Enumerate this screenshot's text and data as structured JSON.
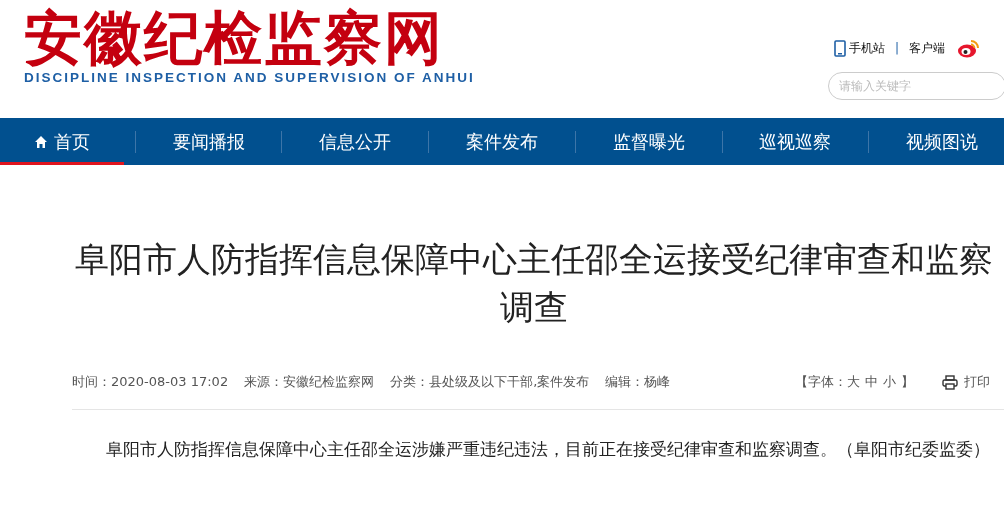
{
  "header": {
    "logo_title": "安徽纪检监察网",
    "logo_subtitle": "DISCIPLINE INSPECTION AND SUPERVISION OF ANHUI",
    "links": [
      {
        "kind": "mobile",
        "label": "手机站"
      },
      {
        "kind": "client",
        "label": "客户端"
      }
    ],
    "separator": "|",
    "search": {
      "placeholder": "请输入关键字"
    }
  },
  "nav": [
    {
      "label": "首页",
      "home": true,
      "selected": true
    },
    {
      "label": "要闻播报",
      "home": false,
      "selected": false
    },
    {
      "label": "信息公开",
      "home": false,
      "selected": false
    },
    {
      "label": "案件发布",
      "home": false,
      "selected": false
    },
    {
      "label": "监督曝光",
      "home": false,
      "selected": false
    },
    {
      "label": "巡视巡察",
      "home": false,
      "selected": false
    },
    {
      "label": "视频图说",
      "home": false,
      "selected": false
    }
  ],
  "article": {
    "title": "阜阳市人防指挥信息保障中心主任邵全运接受纪律审查和监察调查",
    "meta": [
      "时间：2020-08-03 17:02",
      "来源：安徽纪检监察网",
      "分类：县处级及以下干部,案件发布",
      "编辑：杨峰"
    ],
    "font_size": {
      "open": "【字体：",
      "sizes": [
        "大",
        "中",
        "小"
      ],
      "close": "】"
    },
    "print": "打印",
    "body": "阜阳市人防指挥信息保障中心主任邵全运涉嫌严重违纪违法，目前正在接受纪律审查和监察调查。（阜阳市纪委监委）"
  }
}
